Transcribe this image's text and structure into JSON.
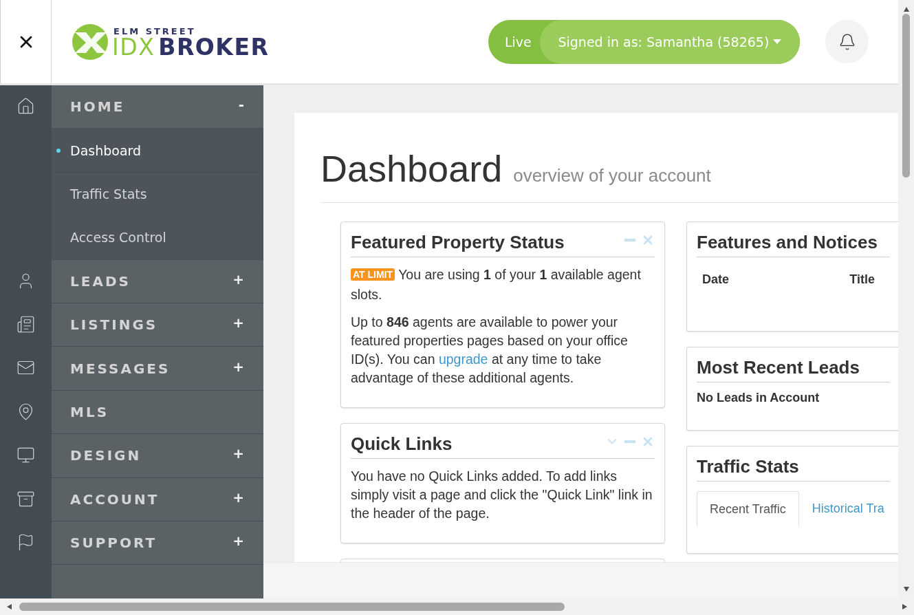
{
  "header": {
    "logo": {
      "top": "ELM STREET",
      "left": "IDX",
      "right": "BROKER"
    },
    "mode": "Live",
    "account": "Signed in as: Samantha (58265)"
  },
  "sidebar": {
    "items": [
      {
        "label": "HOME",
        "toggle": "-",
        "children": [
          {
            "label": "Dashboard",
            "selected": true
          },
          {
            "label": "Traffic Stats",
            "selected": false
          },
          {
            "label": "Access Control",
            "selected": false
          }
        ]
      },
      {
        "label": "LEADS",
        "toggle": "+"
      },
      {
        "label": "LISTINGS",
        "toggle": "+"
      },
      {
        "label": "MESSAGES",
        "toggle": "+"
      },
      {
        "label": "MLS"
      },
      {
        "label": "DESIGN",
        "toggle": "+"
      },
      {
        "label": "ACCOUNT",
        "toggle": "+"
      },
      {
        "label": "SUPPORT",
        "toggle": "+"
      }
    ]
  },
  "page": {
    "title": "Dashboard",
    "subtitle": "overview of your account"
  },
  "left_cards": [
    {
      "title": "Featured Property Status",
      "collapsible": false,
      "paragraphs": [
        [
          {
            "kind": "badge",
            "text": "AT LIMIT"
          },
          {
            "kind": "text",
            "text": " You are using **1** of your **1** available agent slots."
          }
        ],
        [
          {
            "kind": "text",
            "text": "Up to **846** agents are available to power your featured properties pages based on your office ID(s). You can "
          },
          {
            "kind": "link",
            "text": "upgrade"
          },
          {
            "kind": "text",
            "text": " at any time to take advantage of these additional agents."
          }
        ]
      ]
    },
    {
      "title": "Quick Links",
      "collapsible": true,
      "paragraphs": [
        [
          {
            "kind": "text",
            "text": "You have no Quick Links added. To add links simply visit a page and click the \"Quick Link\" link in the header of the page."
          }
        ]
      ]
    }
  ],
  "right_cards": [
    {
      "kind": "table",
      "title": "Features and Notices",
      "columns": [
        "Date",
        "Title"
      ]
    },
    {
      "kind": "message",
      "title": "Most Recent Leads",
      "message": "No Leads in Account"
    },
    {
      "kind": "tabs",
      "title": "Traffic Stats",
      "tabs": [
        {
          "label": "Recent Traffic",
          "selected": true
        },
        {
          "label": "Historical Tra",
          "selected": false
        }
      ]
    }
  ]
}
